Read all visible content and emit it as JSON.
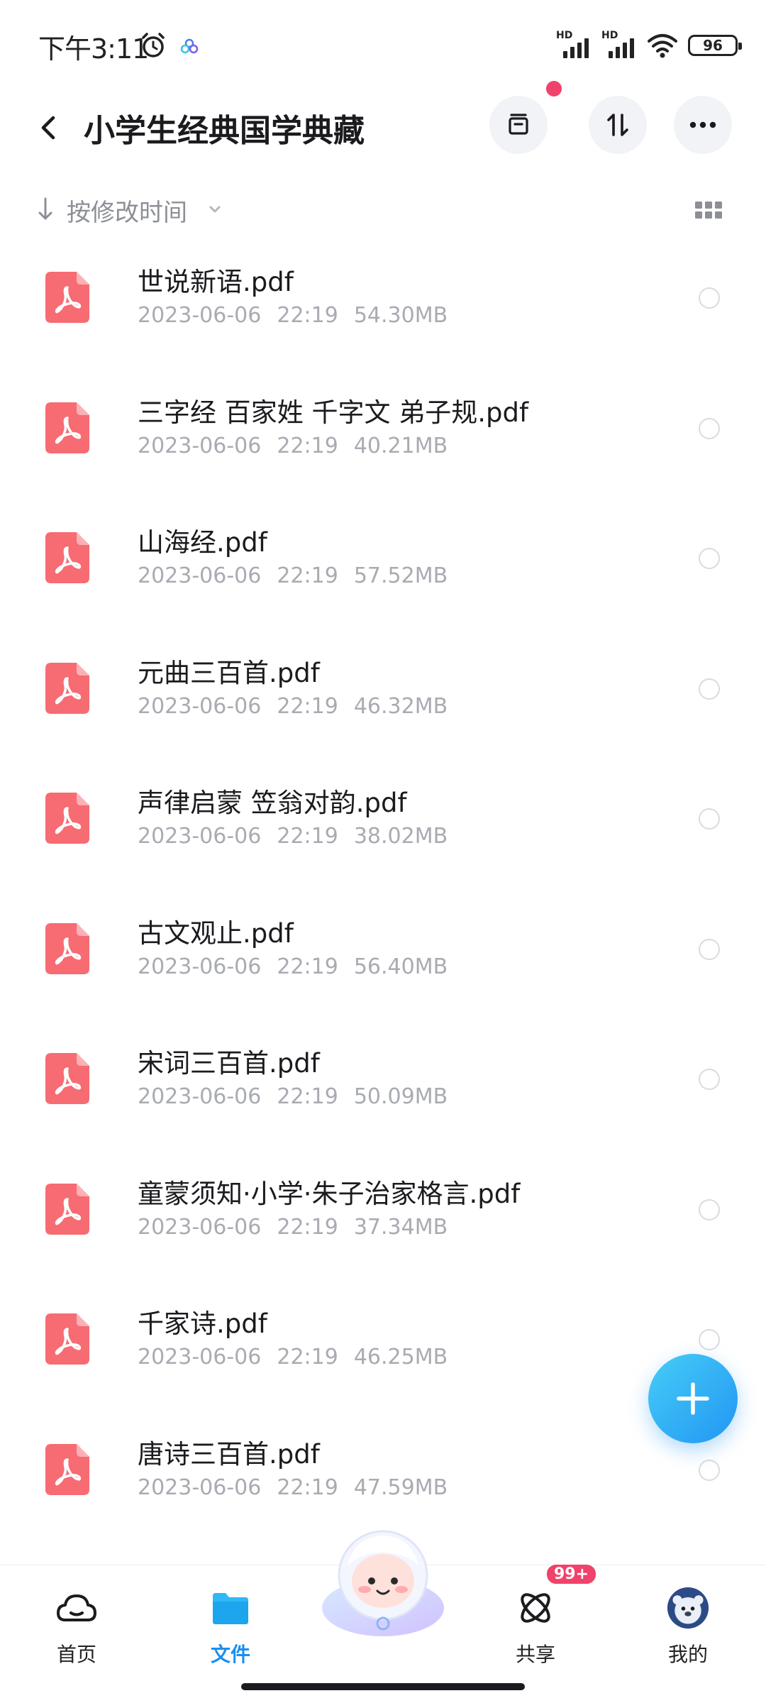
{
  "status_bar": {
    "time": "下午3:11",
    "battery": "96",
    "sim1_label": "HD",
    "sim2_label": "HD"
  },
  "header": {
    "title": "小学生经典国学典藏"
  },
  "sort": {
    "label": "按修改时间"
  },
  "files": [
    {
      "name": "世说新语.pdf",
      "date": "2023-06-06",
      "time": "22:19",
      "size": "54.30MB"
    },
    {
      "name": "三字经 百家姓 千字文 弟子规.pdf",
      "date": "2023-06-06",
      "time": "22:19",
      "size": "40.21MB"
    },
    {
      "name": "山海经.pdf",
      "date": "2023-06-06",
      "time": "22:19",
      "size": "57.52MB"
    },
    {
      "name": "元曲三百首.pdf",
      "date": "2023-06-06",
      "time": "22:19",
      "size": "46.32MB"
    },
    {
      "name": "声律启蒙 笠翁对韵.pdf",
      "date": "2023-06-06",
      "time": "22:19",
      "size": "38.02MB"
    },
    {
      "name": "古文观止.pdf",
      "date": "2023-06-06",
      "time": "22:19",
      "size": "56.40MB"
    },
    {
      "name": "宋词三百首.pdf",
      "date": "2023-06-06",
      "time": "22:19",
      "size": "50.09MB"
    },
    {
      "name": "童蒙须知·小学·朱子治家格言.pdf",
      "date": "2023-06-06",
      "time": "22:19",
      "size": "37.34MB"
    },
    {
      "name": "千家诗.pdf",
      "date": "2023-06-06",
      "time": "22:19",
      "size": "46.25MB"
    },
    {
      "name": "唐诗三百首.pdf",
      "date": "2023-06-06",
      "time": "22:19",
      "size": "47.59MB"
    }
  ],
  "nav": {
    "home": "首页",
    "files": "文件",
    "share": "共享",
    "me": "我的",
    "share_badge": "99+"
  },
  "colors": {
    "accent": "#1a8ff0",
    "pdf": "#f76b72",
    "badge": "#f0426b"
  }
}
